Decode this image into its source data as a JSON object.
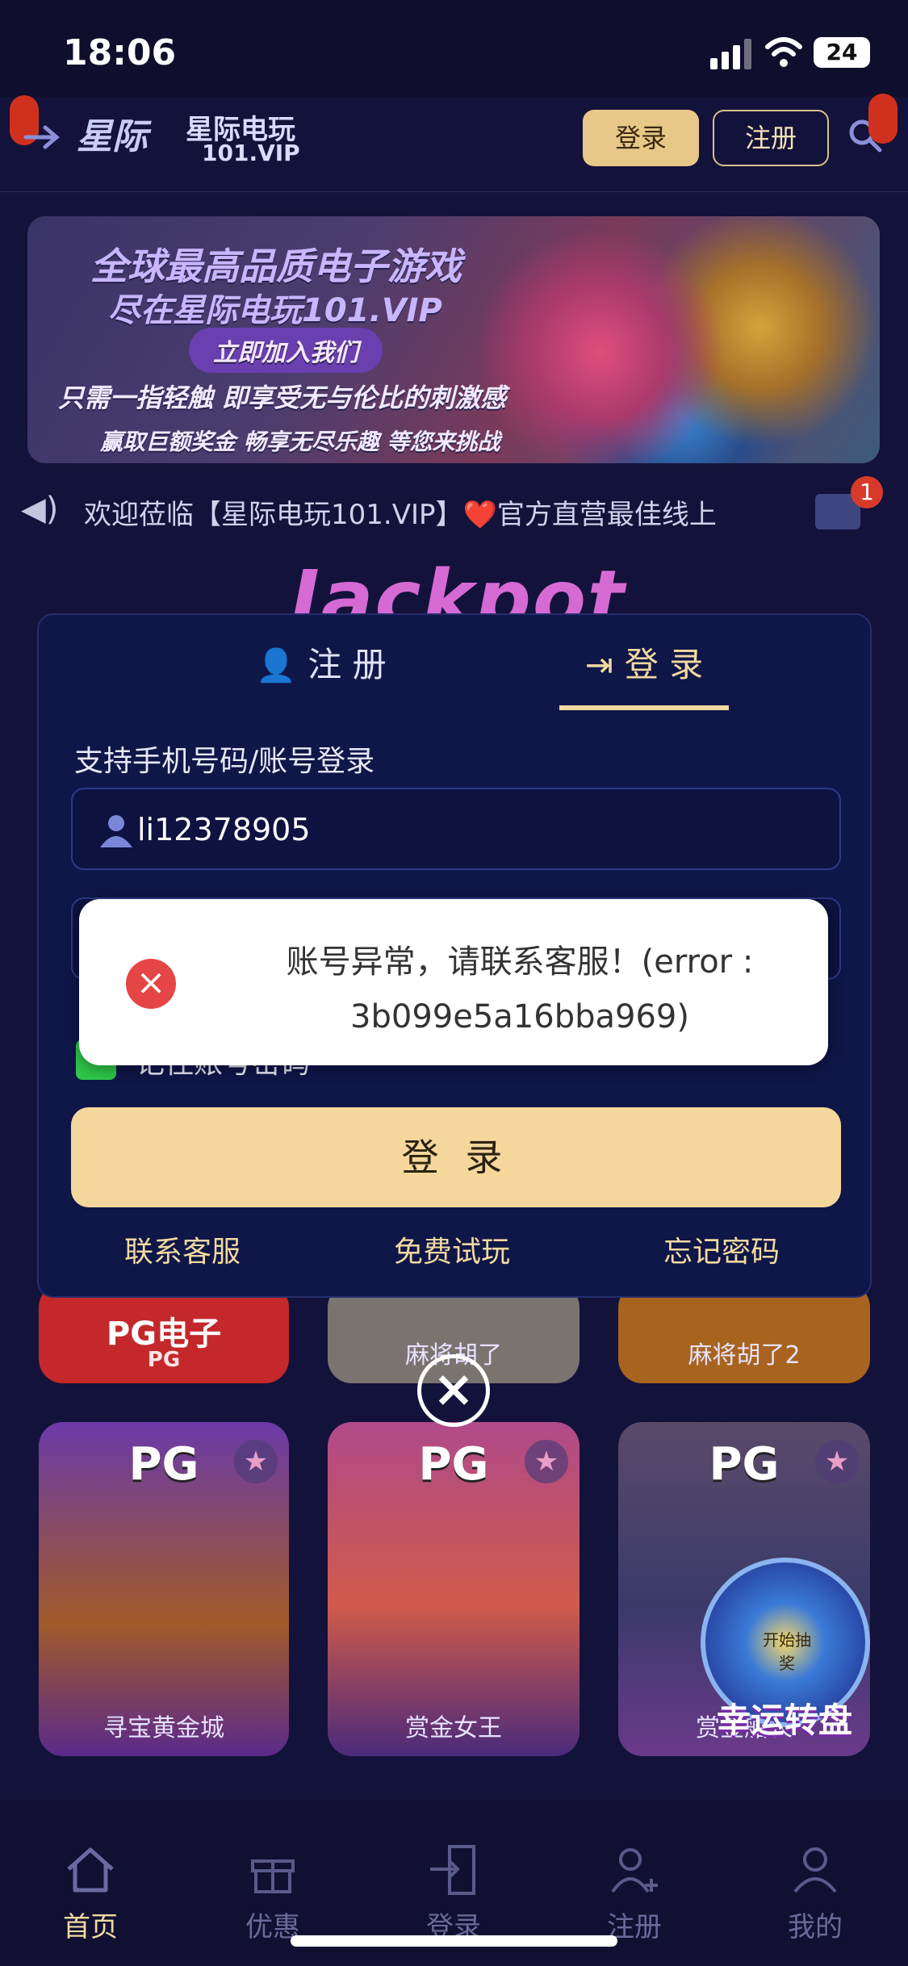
{
  "status_bar": {
    "time": "18:06",
    "battery": "24"
  },
  "header": {
    "logo_mark": "星际",
    "logo_name": "星际电玩",
    "logo_sub": "101.VIP",
    "login_label": "登录",
    "register_label": "注册"
  },
  "banner": {
    "line1": "全球最高品质电子游戏",
    "line2": "尽在星际电玩101.VIP",
    "line3": "立即加入我们",
    "line4": "只需一指轻触 即享受无与伦比的刺激感",
    "line5": "赢取巨额奖金 畅享无尽乐趣 等您来挑战"
  },
  "marquee": {
    "text": "欢迎莅临【星际电玩101.VIP】❤️官方直营最佳线上",
    "mail_count": "1"
  },
  "jackpot_text": "Jackpot",
  "modal": {
    "tab_register": "注 册",
    "tab_login": "登 录",
    "support_text": "支持手机号码/账号登录",
    "username_value": "li12378905",
    "remember_text": "记住账号密码",
    "login_button": "登 录",
    "link_service": "联系客服",
    "link_trial": "免费试玩",
    "link_forgot": "忘记密码"
  },
  "toast": {
    "message": "账号异常，请联系客服！(error : 3b099e5a16bba969)"
  },
  "games": {
    "top_row": [
      "PG电子",
      "麻将胡了",
      "麻将胡了2"
    ],
    "top_row_sub": "PG",
    "bottom_row": [
      {
        "badge": "PG",
        "label": "寻宝黄金城"
      },
      {
        "badge": "PG",
        "label": "赏金女王"
      },
      {
        "badge": "PG",
        "label": "赏金船长"
      }
    ],
    "wheel_label": "幸运转盘",
    "wheel_center": "开始抽奖"
  },
  "bottom_nav": [
    {
      "label": "首页",
      "icon": "home-icon",
      "active": true
    },
    {
      "label": "优惠",
      "icon": "gift-icon",
      "active": false
    },
    {
      "label": "登录",
      "icon": "login-icon",
      "active": false
    },
    {
      "label": "注册",
      "icon": "add-user-icon",
      "active": false
    },
    {
      "label": "我的",
      "icon": "profile-icon",
      "active": false
    }
  ],
  "colors": {
    "background": "#13123a",
    "accent_gold": "#f5d79c",
    "modal_bg": "#0f1648",
    "error_red": "#e54545"
  }
}
